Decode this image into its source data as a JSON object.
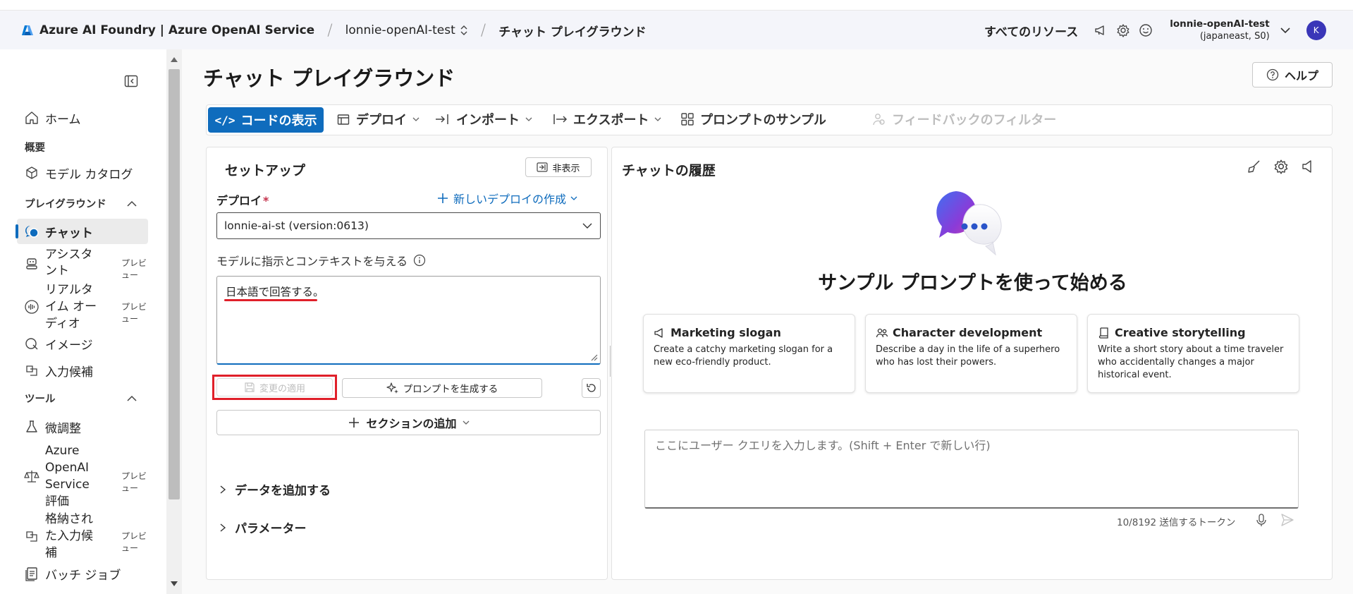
{
  "topbar": {
    "app_title": "Azure AI Foundry | Azure OpenAI Service",
    "project": "lonnie-openAI-test",
    "page": "チャット プレイグラウンド",
    "all_resources": "すべてのリソース",
    "account_name": "lonnie-openAI-test",
    "account_region": "(japaneast, S0)",
    "avatar_initial": "K"
  },
  "sidebar": {
    "home": "ホーム",
    "overview_header": "概要",
    "model_catalog": "モデル カタログ",
    "playground_header": "プレイグラウンド",
    "chat": "チャット",
    "assistants": "アシスタント",
    "realtime": "リアルタイム オーディオ",
    "image": "イメージ",
    "completions": "入力候補",
    "tools_header": "ツール",
    "finetune": "微調整",
    "eval": "Azure OpenAI Service 評価",
    "stored": "格納された入力候補",
    "batch": "バッチ ジョブ",
    "preview": "プレビュー"
  },
  "main": {
    "title": "チャット プレイグラウンド",
    "help": "ヘルプ",
    "toolbar": {
      "view_code": "コードの表示",
      "deploy": "デプロイ",
      "import": "インポート",
      "export": "エクスポート",
      "prompt_samples": "プロンプトのサンプル",
      "feedback_filter": "フィードバックのフィルター"
    }
  },
  "setup": {
    "title": "セットアップ",
    "hide": "非表示",
    "deploy_label": "デプロイ",
    "required_mark": "*",
    "new_deploy": "新しいデプロイの作成",
    "deployment_value": "lonnie-ai-st (version:0613)",
    "instructions_label": "モデルに指示とコンテキストを与える",
    "system_message": "日本語で回答する。",
    "apply_changes": "変更の適用",
    "generate_prompt": "プロンプトを生成する",
    "add_section": "セクションの追加",
    "add_data": "データを追加する",
    "parameters": "パラメーター"
  },
  "chat": {
    "title": "チャットの履歴",
    "start_heading": "サンプル プロンプトを使って始める",
    "cards": [
      {
        "title": "Marketing slogan",
        "desc": "Create a catchy marketing slogan for a new eco-friendly product."
      },
      {
        "title": "Character development",
        "desc": "Describe a day in the life of a superhero who has lost their powers."
      },
      {
        "title": "Creative storytelling",
        "desc": "Write a short story about a time traveler who accidentally changes a major historical event."
      }
    ],
    "input_placeholder": "ここにユーザー クエリを入力します。(Shift + Enter で新しい行)",
    "token_count": "10/8192 送信するトークン"
  },
  "colors": {
    "accent": "#0f6cbd",
    "annotation_red": "#e0202a",
    "topbar_bg": "#f4f5fa",
    "chat_bubble": "#6b4fe0"
  }
}
